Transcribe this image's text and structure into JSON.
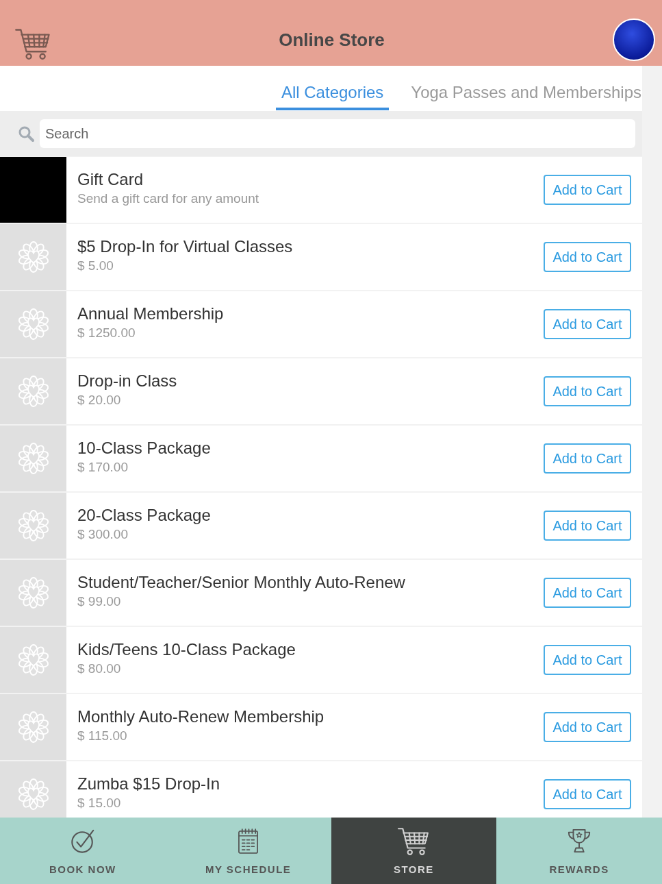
{
  "header": {
    "title": "Online Store"
  },
  "tabs": [
    {
      "label": "All Categories",
      "selected": true
    },
    {
      "label": "Yoga Passes and Memberships",
      "selected": false
    }
  ],
  "search": {
    "placeholder": "Search"
  },
  "products": [
    {
      "kind": "logo",
      "name": "Gift Card",
      "subtitle": "Send a gift card for any amount",
      "button": "Add to Cart"
    },
    {
      "kind": "placeholder",
      "name": "$5 Drop-In for Virtual Classes",
      "subtitle": "$ 5.00",
      "button": "Add to Cart"
    },
    {
      "kind": "placeholder",
      "name": "Annual Membership",
      "subtitle": "$ 1250.00",
      "button": "Add to Cart"
    },
    {
      "kind": "placeholder",
      "name": "Drop-in Class",
      "subtitle": "$ 20.00",
      "button": "Add to Cart"
    },
    {
      "kind": "placeholder",
      "name": "10-Class Package",
      "subtitle": "$ 170.00",
      "button": "Add to Cart"
    },
    {
      "kind": "placeholder",
      "name": "20-Class Package",
      "subtitle": "$ 300.00",
      "button": "Add to Cart"
    },
    {
      "kind": "placeholder",
      "name": "Student/Teacher/Senior Monthly Auto-Renew",
      "subtitle": "$ 99.00",
      "button": "Add to Cart"
    },
    {
      "kind": "placeholder",
      "name": "Kids/Teens 10-Class Package",
      "subtitle": "$ 80.00",
      "button": "Add to Cart"
    },
    {
      "kind": "placeholder",
      "name": "Monthly Auto-Renew Membership",
      "subtitle": "$ 115.00",
      "button": "Add to Cart"
    },
    {
      "kind": "placeholder",
      "name": "Zumba $15 Drop-In",
      "subtitle": "$ 15.00",
      "button": "Add to Cart"
    }
  ],
  "nav": [
    {
      "label": "BOOK NOW",
      "selected": false
    },
    {
      "label": "MY SCHEDULE",
      "selected": false
    },
    {
      "label": "STORE",
      "selected": true
    },
    {
      "label": "REWARDS",
      "selected": false
    }
  ]
}
